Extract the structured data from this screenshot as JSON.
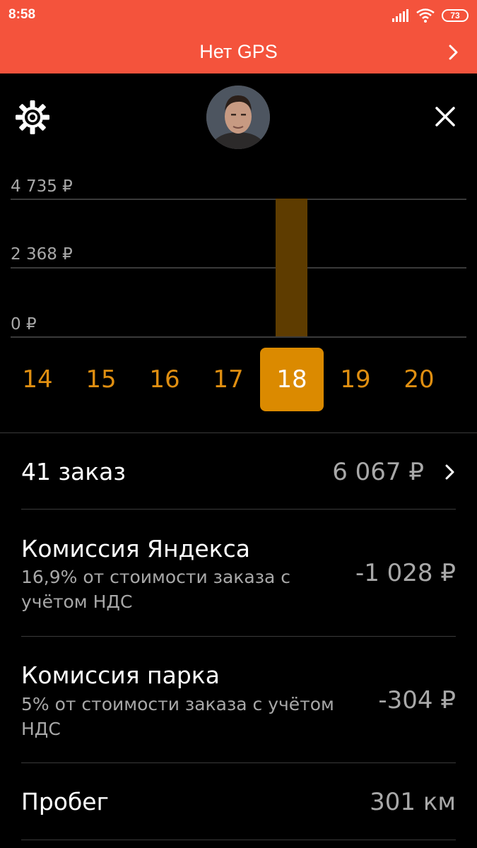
{
  "status_bar": {
    "time": "8:58",
    "battery": "73",
    "icons": [
      "signal-icon",
      "wifi-icon",
      "battery-icon"
    ]
  },
  "gps_banner": {
    "title": "Нет GPS"
  },
  "header": {
    "settings_icon": "gear-icon",
    "close_icon": "close-icon",
    "avatar": "driver-avatar"
  },
  "chart": {
    "y_labels": [
      "4 735 ₽",
      "2 368 ₽",
      "0 ₽"
    ]
  },
  "chart_data": {
    "type": "bar",
    "categories": [
      "14",
      "15",
      "16",
      "17",
      "18",
      "19",
      "20"
    ],
    "values": [
      0,
      0,
      0,
      0,
      4735,
      0,
      0
    ],
    "ylim": [
      0,
      4735
    ],
    "ytick_labels": [
      "0 ₽",
      "2 368 ₽",
      "4 735 ₽"
    ],
    "grid": true,
    "bar_color": "#5e3c00",
    "selected_category": "18"
  },
  "dates": {
    "items": [
      "14",
      "15",
      "16",
      "17",
      "18",
      "19",
      "20"
    ],
    "selected": "18"
  },
  "summary": {
    "orders": {
      "label": "41 заказ",
      "value": "6 067 ₽"
    },
    "yandex_commission": {
      "title": "Комиссия Яндекса",
      "subtitle": "16,9% от стоимости заказа с учётом НДС",
      "value": "-1 028 ₽"
    },
    "park_commission": {
      "title": "Комиссия парка",
      "subtitle": "5% от стоимости заказа с учётом НДС",
      "value": "-304 ₽"
    },
    "mileage": {
      "label": "Пробег",
      "value": "301 км"
    }
  },
  "colors": {
    "banner": "#f4533c",
    "accent": "#e08f11",
    "selected_bg": "#db8a00",
    "bar": "#5e3c00",
    "background": "#000000"
  }
}
